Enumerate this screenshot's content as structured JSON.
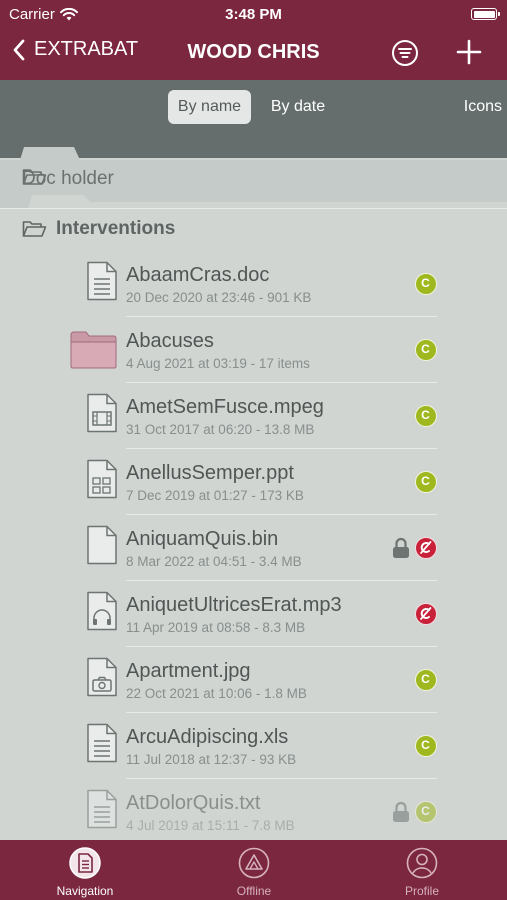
{
  "status": {
    "carrier": "Carrier",
    "time": "3:48 PM"
  },
  "nav": {
    "back_label": "EXTRABAT",
    "title": "WOOD CHRIS"
  },
  "segments": {
    "by_name": "By name",
    "by_date": "By date",
    "icons": "Icons"
  },
  "breadcrumb": {
    "parent": "Doc holder"
  },
  "section": {
    "title": "Interventions"
  },
  "files": [
    {
      "name": "AbaamCras.doc",
      "meta": "20 Dec 2020 at 23:46 - 901 KB",
      "icon": "document-lines-icon",
      "badge": "checked-in",
      "locked": false
    },
    {
      "name": "Abacuses",
      "meta": "4 Aug 2021 at 03:19 - 17 items",
      "icon": "folder-icon",
      "badge": "checked-in",
      "locked": false
    },
    {
      "name": "AmetSemFusce.mpeg",
      "meta": "31 Oct 2017 at 06:20 - 13.8 MB",
      "icon": "video-file-icon",
      "badge": "checked-in",
      "locked": false
    },
    {
      "name": "AnellusSemper.ppt",
      "meta": "7 Dec 2019 at 01:27 - 173 KB",
      "icon": "presentation-file-icon",
      "badge": "checked-in",
      "locked": false
    },
    {
      "name": "AniquamQuis.bin",
      "meta": "8 Mar 2022 at 04:51 - 3.4 MB",
      "icon": "blank-file-icon",
      "badge": "not-synced",
      "locked": true
    },
    {
      "name": "AniquetUltricesErat.mp3",
      "meta": "11 Apr 2019 at 08:58 - 8.3 MB",
      "icon": "audio-file-icon",
      "badge": "not-synced",
      "locked": false
    },
    {
      "name": "Apartment.jpg",
      "meta": "22 Oct 2021 at 10:06 - 1.8 MB",
      "icon": "image-file-icon",
      "badge": "checked-in",
      "locked": false
    },
    {
      "name": "ArcuAdipiscing.xls",
      "meta": "11 Jul 2018 at 12:37 - 93 KB",
      "icon": "document-lines-icon",
      "badge": "checked-in",
      "locked": false
    },
    {
      "name": "AtDolorQuis.txt",
      "meta": "4 Jul 2019 at 15:11 - 7.8 MB",
      "icon": "document-lines-icon",
      "badge": "checked-in",
      "locked": true
    }
  ],
  "badge_letter": "C",
  "tabbar": {
    "navigation": "Navigation",
    "offline": "Offline",
    "profile": "Profile"
  },
  "colors": {
    "brand": "#7b2740",
    "check": "#9fb81f",
    "alert": "#c8213a",
    "toolbar": "#656e6c"
  }
}
